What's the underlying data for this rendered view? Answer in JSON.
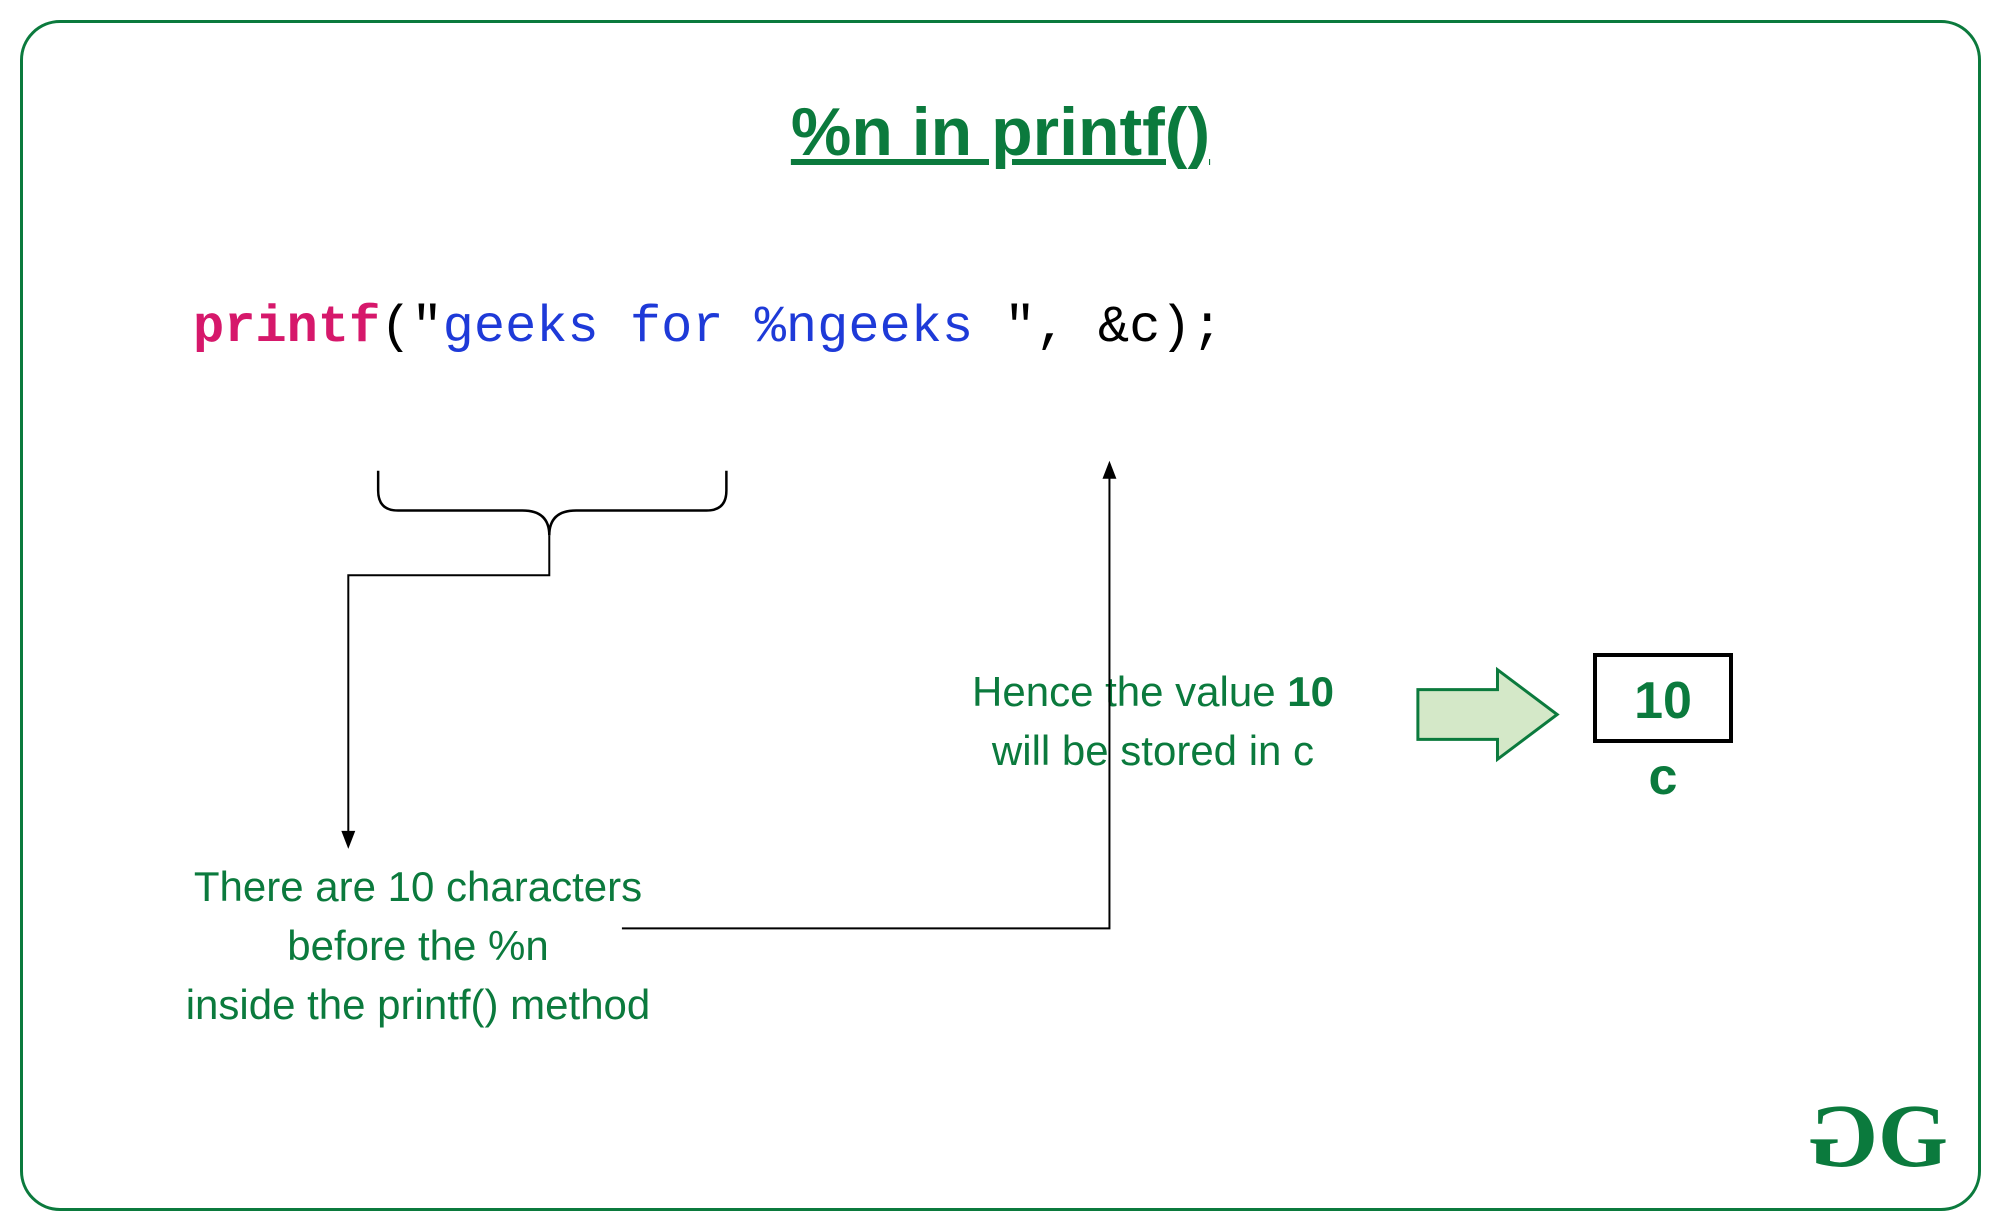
{
  "title": "%n in printf()",
  "code": {
    "fn": "printf",
    "open": "(",
    "quote1": "\"",
    "str": "geeks for %ngeeks ",
    "quote2": "\"",
    "tail": ", &c);"
  },
  "explain_left": "There are 10 characters\nbefore the %n\ninside the printf() method",
  "explain_right_prefix": "Hence the value ",
  "explain_right_bold": "10",
  "explain_right_suffix": "\nwill be stored in c",
  "box_value": "10",
  "box_label": "c",
  "logo_g1": "G",
  "logo_g2": "G",
  "colors": {
    "frame": "#0b7a3d",
    "fn": "#d6186b",
    "str": "#1e3ad8",
    "arrow_fill": "#d4e8c8"
  }
}
